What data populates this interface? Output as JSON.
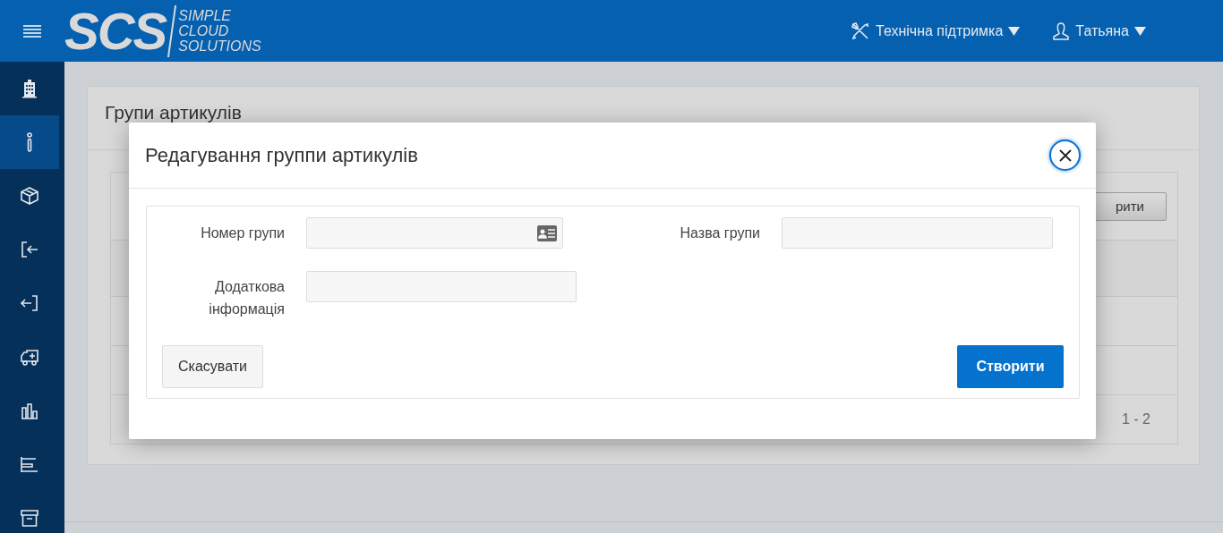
{
  "header": {
    "logo": {
      "mark": "SCS",
      "lines": [
        "SIMPLE",
        "CLOUD",
        "SOLUTIONS"
      ]
    },
    "menus": [
      {
        "kind": "support",
        "label": "Технічна підтримка"
      },
      {
        "kind": "user",
        "label": "Татьяна"
      }
    ]
  },
  "sidebar": {
    "items": [
      {
        "selected": false
      },
      {
        "selected": true
      },
      {
        "selected": false
      },
      {
        "selected": false
      },
      {
        "selected": false
      },
      {
        "selected": false
      },
      {
        "selected": false
      },
      {
        "selected": false
      },
      {
        "selected": false
      }
    ]
  },
  "page": {
    "title": "Групи артикулів",
    "toolbar_button": "рити",
    "pagination": "1 - 2"
  },
  "dialog": {
    "title": "Редагування группи артикулів",
    "fields": [
      {
        "label": "Номер групи",
        "kind": "lookup"
      },
      {
        "label": "Назва групи",
        "kind": "text"
      },
      {
        "label": "Додаткова інформація",
        "kind": "text"
      }
    ],
    "cancel": "Скасувати",
    "submit": "Створити"
  }
}
